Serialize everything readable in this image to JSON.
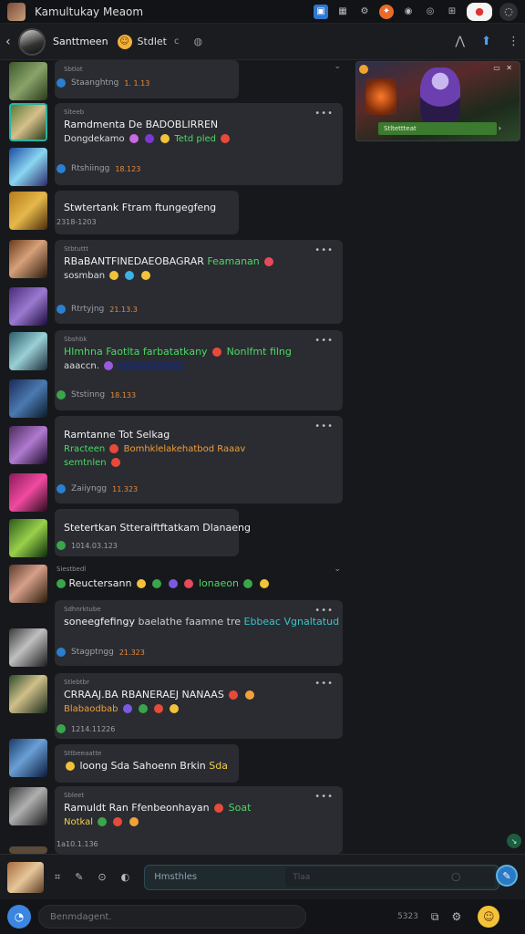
{
  "app": {
    "title": "Kamultukay Meaom"
  },
  "colors": {
    "accent": "#2a79c4",
    "bubble": "#2a2c31",
    "background": "#17181b",
    "time": "#e78a3a",
    "green_text": "#4cd964"
  },
  "topbar": {
    "icons": [
      "square-blue-icon",
      "grid-icon",
      "settings-icon",
      "flame-icon",
      "gamepad-icon",
      "dash-icon",
      "grid-small-icon",
      "notification-pill-icon",
      "profile-icon"
    ]
  },
  "channel": {
    "name": "Santtmeen",
    "status": "Stdlet",
    "c_label": "c"
  },
  "messages": [
    {
      "meta": "Sbtlot",
      "footer": "Staanghtng",
      "time": "1. 1.13"
    },
    {
      "meta": "Slteeb",
      "title": "Ramdmenta De BADOBLIRREN",
      "line2": "Dongdekamo",
      "line2_green": "Tetd pled",
      "footer": "Rtshiingg",
      "time": "18.123"
    },
    {
      "title": "Stwtertank Ftram ftungegfeng",
      "footer": "2318-1203"
    },
    {
      "meta": "Stbtuttt",
      "title": "RBaBANTFINEDAEOBAGRAR",
      "title_green": "Feamanan",
      "line2": "sosmban",
      "footer": "Rtrtyjng",
      "time": "21.13.3"
    },
    {
      "meta": "Sbshbk",
      "line1_green": "Hlmhna Faotlta farbatatkany",
      "line1_green2": "Nonlfmt filng",
      "line2": "aaaccn.",
      "footer": "Ststinng",
      "time": "18.133"
    },
    {
      "title": "Ramtanne Tot Selkag",
      "line2_green": "Rracteen",
      "line2_orange": "Bomhklelakehatbod Raaav",
      "line3_green": "semtnlen",
      "footer": "Zaiiyngg",
      "time": "11.323"
    },
    {
      "title": "Stetertkan Stteraiftftatkam Dlanaeng",
      "footer": "1014.03.123"
    },
    {
      "meta": "Siestbedl",
      "title": "Reuctersann",
      "title_green": "lonaeon",
      "footer": ""
    },
    {
      "meta": "Sdhnrktube",
      "title": "soneegfefingy",
      "title_mid": "baelathe faamne tre",
      "title_teal": "Ebbeac Vgnaltatud",
      "footer": "Stagptngg",
      "time": "21.323"
    },
    {
      "meta": "Stlebtbr",
      "title": "CRRAAJ.BA RBANERAEJ NANAAS",
      "line2": "Blabaodbab",
      "footer": "1214.11226"
    },
    {
      "meta": "Sttbeeaatte",
      "title": "loong Sda Sahoenn Brkin",
      "title_yellow": "Sda",
      "footer": ""
    },
    {
      "meta": "Sbleet",
      "title": "Ramuldt Ran Ffenbeonhayan",
      "title_green": "Soat",
      "line2_yellow": "Notkal",
      "footer": "1a10.1.136"
    }
  ],
  "video": {
    "bar_text": "Stltettteat"
  },
  "composer": {
    "placeholder": "Hmsthles",
    "inner_placeholder": "Tlaa"
  },
  "bottombar": {
    "search_placeholder": "Benmdagent.",
    "count": "5323"
  }
}
